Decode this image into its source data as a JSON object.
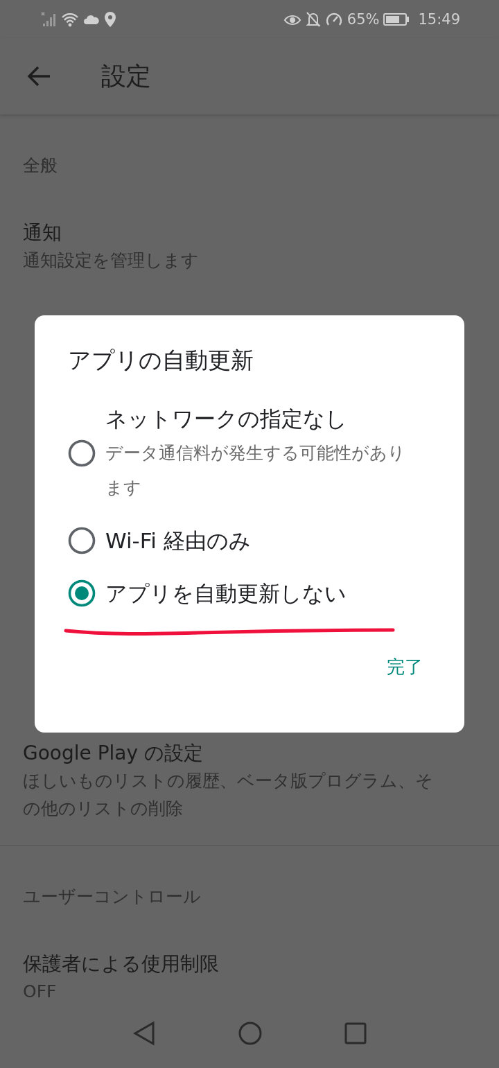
{
  "status_bar": {
    "battery": "65%",
    "time": "15:49"
  },
  "toolbar": {
    "title": "設定"
  },
  "sections": [
    {
      "header": "全般",
      "items": [
        {
          "title": "通知",
          "subtitle": [
            "通知設定を管理します"
          ]
        },
        {
          "title": "Google Play の設定",
          "subtitle": [
            "ほしいものリストの履歴、ベータ版プログラム、そ",
            "の他のリストの削除"
          ]
        }
      ]
    },
    {
      "header": "ユーザーコントロール",
      "items": [
        {
          "title": "保護者による使用制限",
          "subtitle": [
            "OFF"
          ]
        }
      ]
    }
  ],
  "dialog": {
    "title": "アプリの自動更新",
    "options": [
      {
        "label": "ネットワークの指定なし",
        "description": [
          "データ通信料が発生する可能性があり",
          "ます"
        ],
        "selected": false
      },
      {
        "label": "Wi-Fi 経由のみ",
        "selected": false
      },
      {
        "label": "アプリを自動更新しない",
        "selected": true
      }
    ],
    "button": "完了"
  }
}
